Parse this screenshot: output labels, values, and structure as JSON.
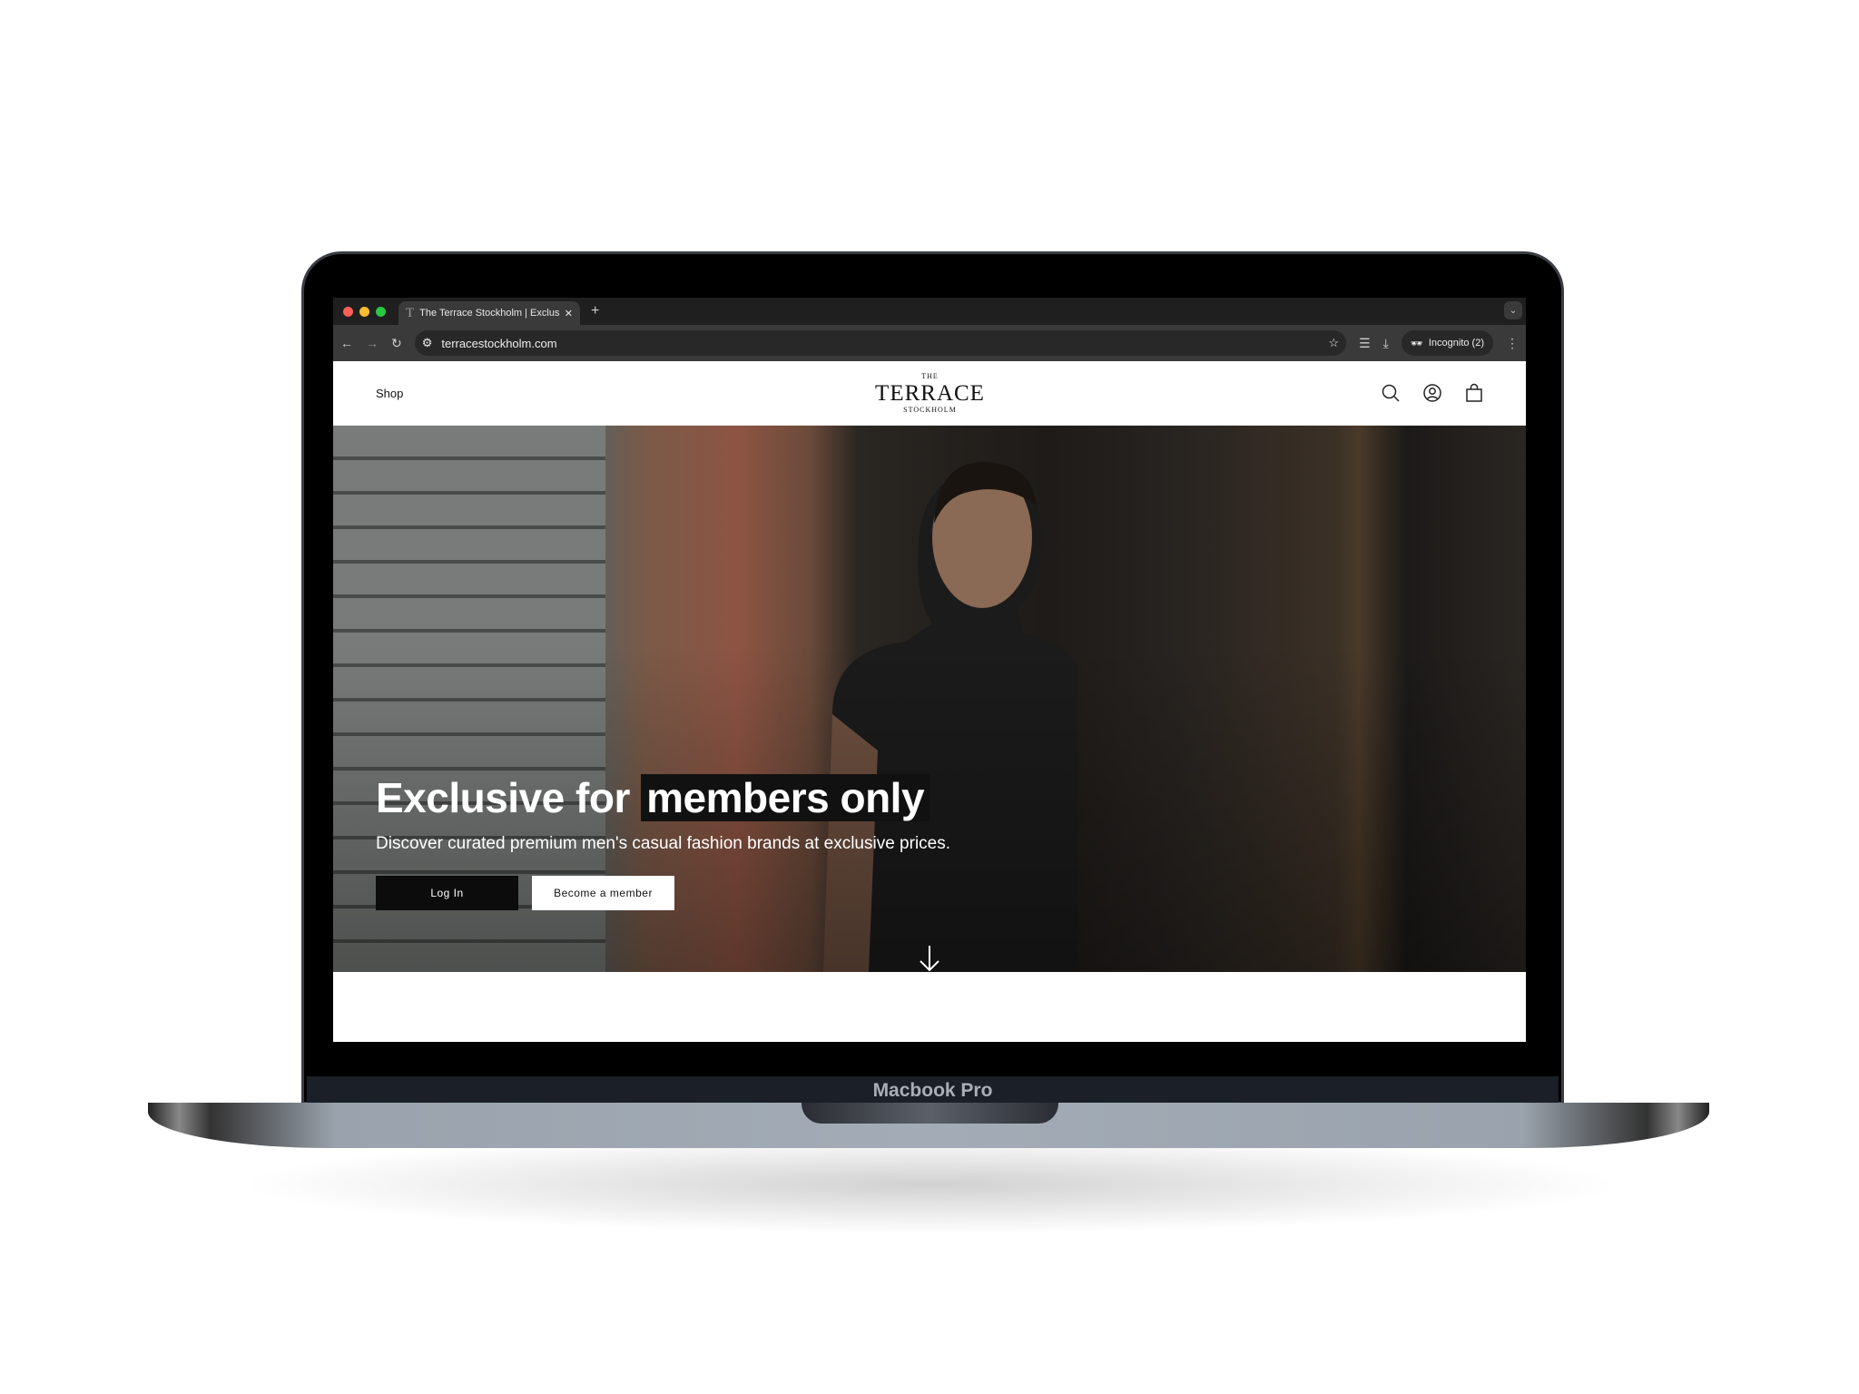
{
  "device": {
    "label": "Macbook Pro"
  },
  "browser": {
    "tab_title": "The Terrace Stockholm | Exclusive",
    "tab_favicon": "T",
    "url": "terracestockholm.com",
    "profile": "Incognito (2)"
  },
  "site": {
    "nav_shop": "Shop",
    "logo": {
      "top": "THE",
      "main": "TERRACE",
      "bottom": "STOCKHOLM"
    },
    "hero": {
      "headline_plain": "Exclusive for ",
      "headline_highlight": "members only",
      "subtitle": "Discover curated premium men's casual fashion brands at exclusive prices.",
      "login_label": "Log In",
      "member_label": "Become a member"
    }
  },
  "colors": {
    "accent": "#111111",
    "traffic": [
      "#ff5f57",
      "#febc2e",
      "#28c840"
    ]
  }
}
